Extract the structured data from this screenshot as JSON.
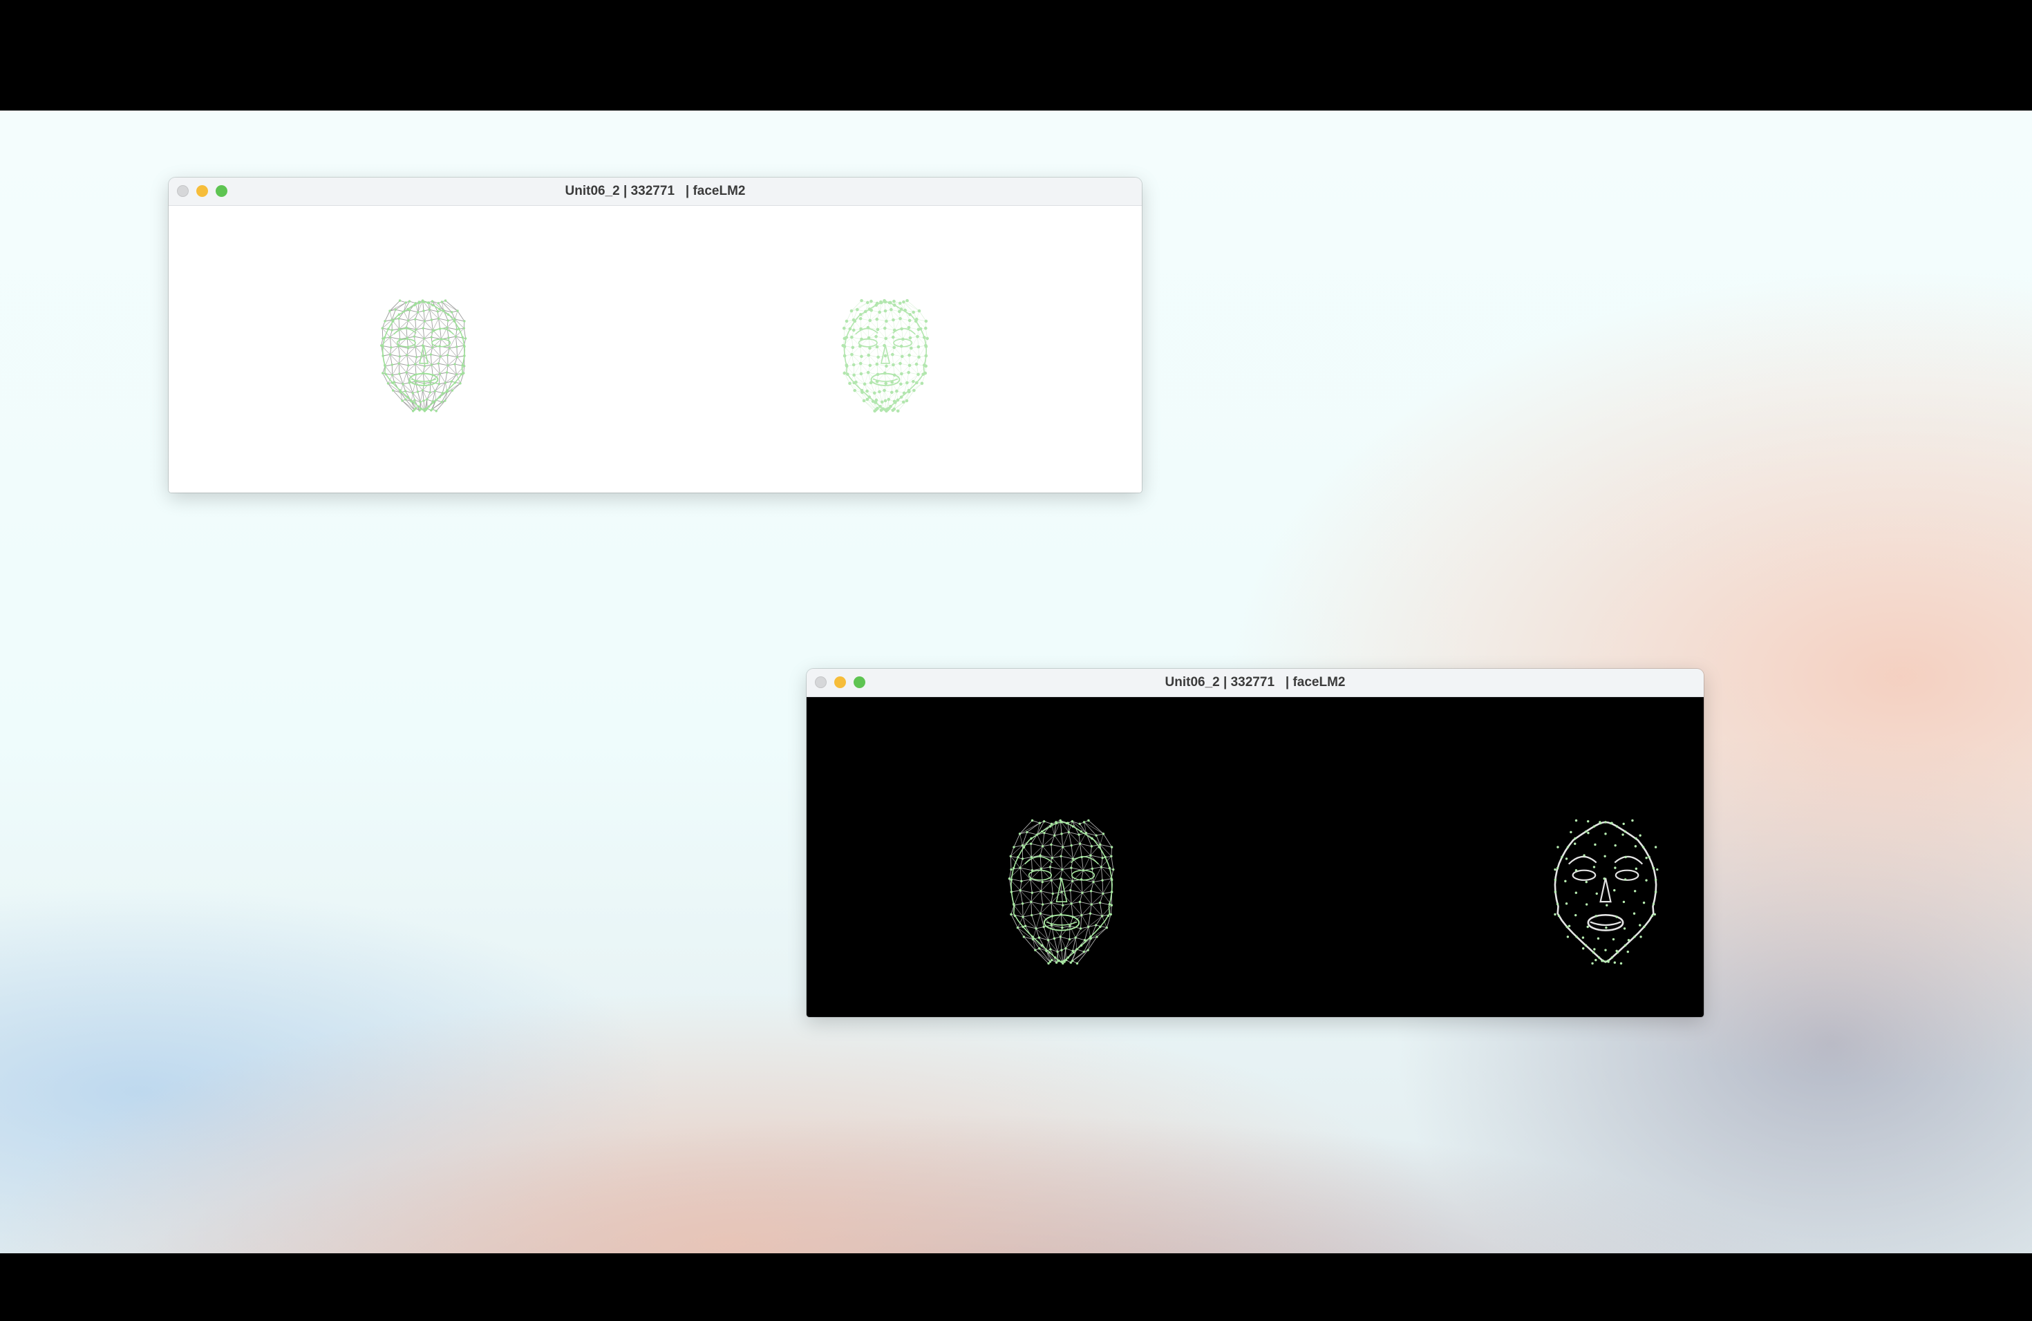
{
  "desktop": {
    "windows": [
      {
        "title": "Unit06_2 | 332771   | faceLM2",
        "canvas_background": "#ffffff",
        "faces": [
          {
            "style": "tessellation",
            "mesh_color": "#8a8a8a",
            "landmark_color": "#9fe09a"
          },
          {
            "style": "landmarks",
            "mesh_color": "#c4eac1",
            "landmark_color": "#b2e6ae"
          }
        ]
      },
      {
        "title": "Unit06_2 | 332771   | faceLM2",
        "canvas_background": "#000000",
        "faces": [
          {
            "style": "tessellation",
            "mesh_color": "#d0d0d0",
            "landmark_color": "#a8e8a2"
          },
          {
            "style": "contours",
            "mesh_color": "#e4e4e4",
            "landmark_color": "#b6ecb0"
          }
        ]
      }
    ]
  },
  "colors": {
    "traffic_close": "#d6d7d9",
    "traffic_minimize": "#f6bd3a",
    "traffic_maximize": "#5ec452",
    "titlebar": "#f2f4f6"
  }
}
